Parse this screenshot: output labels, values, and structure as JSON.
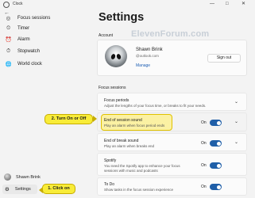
{
  "window": {
    "title": "Clock",
    "controls": [
      "—",
      "□",
      "✕"
    ]
  },
  "sidebar": {
    "items": [
      {
        "label": "Focus sessions",
        "icon": "focus-icon",
        "glyph": "◎"
      },
      {
        "label": "Timer",
        "icon": "timer-icon",
        "glyph": "⏲"
      },
      {
        "label": "Alarm",
        "icon": "alarm-icon",
        "glyph": "⏰"
      },
      {
        "label": "Stopwatch",
        "icon": "stopwatch-icon",
        "glyph": "⏱"
      },
      {
        "label": "World clock",
        "icon": "globe-icon",
        "glyph": "🌐"
      }
    ],
    "user": "Shawn Brink",
    "settings": {
      "label": "Settings",
      "glyph": "⚙"
    }
  },
  "main": {
    "title": "Settings",
    "account": {
      "section_label": "Account",
      "name": "Shawn Brink",
      "email": "@outlook.com",
      "manage": "Manage",
      "sign_out": "Sign out"
    },
    "watermark": "ElevenForum.com",
    "focus": {
      "section_label": "Focus sessions",
      "periods": {
        "title": "Focus periods",
        "desc": "Adjust the lengths of your focus time, or breaks to fit your needs."
      },
      "end_session": {
        "title": "End of session sound",
        "desc": "Play an alarm when focus period ends",
        "state": "On"
      },
      "end_break": {
        "title": "End of break sound",
        "desc": "Play an alarm when breaks end",
        "state": "On"
      },
      "spotify": {
        "title": "Spotify",
        "desc": "You need the Spotify app to enhance your focus sessions with music and podcasts",
        "state": "On"
      },
      "todo": {
        "title": "To Do",
        "desc": "Show tasks in the focus session experience",
        "state": "On"
      }
    }
  },
  "callouts": {
    "step1": "1. Click on",
    "step2": "2. Turn On or Off"
  },
  "colors": {
    "accent": "#1f5fa8",
    "callout": "#f8ec38",
    "link": "#1e5fb4"
  }
}
